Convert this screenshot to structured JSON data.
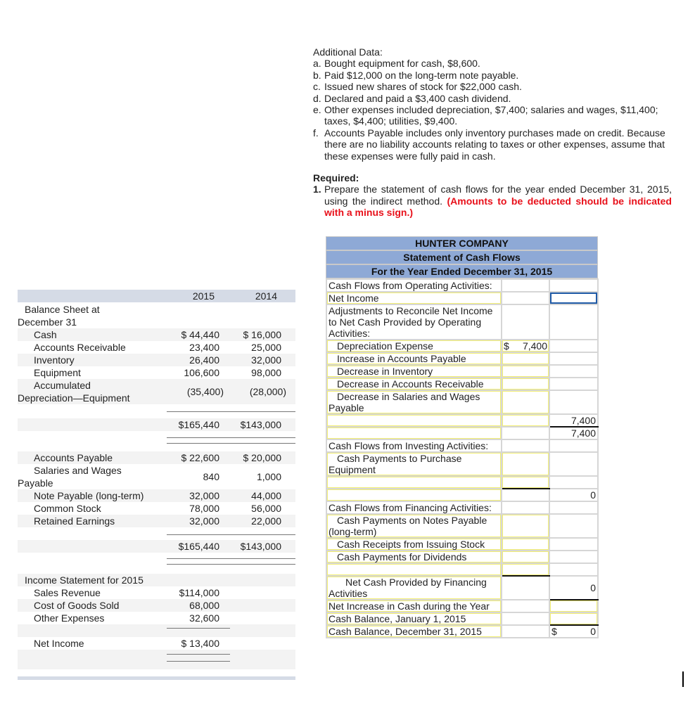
{
  "additional_data": {
    "title": "Additional Data:",
    "items": [
      {
        "label": "a.",
        "text": "Bought equipment for cash, $8,600."
      },
      {
        "label": "b.",
        "text": "Paid $12,000 on the long-term note payable."
      },
      {
        "label": "c.",
        "text": "Issued new shares of stock for $22,000 cash."
      },
      {
        "label": "d.",
        "text": "Declared and paid a $3,400 cash dividend."
      },
      {
        "label": "e.",
        "text": "Other expenses included depreciation, $7,400; salaries and wages, $11,400; taxes, $4,400; utilities, $9,400."
      },
      {
        "label": "f.",
        "text": "Accounts Payable includes only inventory purchases made on credit. Because there are no liability accounts relating to taxes or other expenses, assume that these expenses were fully paid in cash."
      }
    ]
  },
  "required": {
    "title": "Required:",
    "label": "1.",
    "text": "Prepare the statement of cash flows for the year ended December 31, 2015, using the indirect method. ",
    "note": "(Amounts to be deducted should be indicated with a minus sign.)",
    "note_color": "#e8101a"
  },
  "balance_sheet": {
    "col_2015": "2015",
    "col_2014": "2014",
    "title_line1": "Balance Sheet at",
    "title_line2": "December 31",
    "assets": [
      {
        "label": "Cash",
        "v2015": "$ 44,440",
        "v2014": "$ 16,000"
      },
      {
        "label": "Accounts Receivable",
        "v2015": "23,400",
        "v2014": "25,000"
      },
      {
        "label": "Inventory",
        "v2015": "26,400",
        "v2014": "32,000"
      },
      {
        "label": "Equipment",
        "v2015": "106,600",
        "v2014": "98,000"
      },
      {
        "label1": "Accumulated",
        "label2": "Depreciation—Equipment",
        "v2015": "(35,400)",
        "v2014": "(28,000)"
      }
    ],
    "total_assets": {
      "v2015": "$165,440",
      "v2014": "$143,000"
    },
    "liabilities": [
      {
        "label": "Accounts Payable",
        "v2015": "$ 22,600",
        "v2014": "$ 20,000"
      },
      {
        "label1": "Salaries and Wages",
        "label2": "Payable",
        "v2015": "840",
        "v2014": "1,000"
      },
      {
        "label": "Note Payable (long-term)",
        "v2015": "32,000",
        "v2014": "44,000"
      },
      {
        "label": "Common Stock",
        "v2015": "78,000",
        "v2014": "56,000"
      },
      {
        "label": "Retained Earnings",
        "v2015": "32,000",
        "v2014": "22,000"
      }
    ],
    "total_liabilities": {
      "v2015": "$165,440",
      "v2014": "$143,000"
    }
  },
  "income_statement": {
    "title": "Income Statement for 2015",
    "items": [
      {
        "label": "Sales Revenue",
        "value": "$114,000"
      },
      {
        "label": "Cost of Goods Sold",
        "value": "68,000"
      },
      {
        "label": "Other Expenses",
        "value": "32,600"
      }
    ],
    "net_income": {
      "label": "Net Income",
      "value": "$ 13,400"
    }
  },
  "cash_flow": {
    "company": "HUNTER COMPANY",
    "statement": "Statement of Cash Flows",
    "period": "For the Year Ended December 31, 2015",
    "operating_header": "Cash Flows from Operating Activities:",
    "net_income": "Net Income",
    "adjustments_header": "Adjustments to Reconcile Net Income to Net Cash Provided by Operating Activities:",
    "depreciation": {
      "label": "Depreciation Expense",
      "currency": "$",
      "value": "7,400"
    },
    "increase_ap": "Increase in Accounts Payable",
    "decrease_inventory": "Decrease in Inventory",
    "decrease_ar": "Decrease in Accounts Receivable",
    "decrease_salaries": "Decrease in Salaries and Wages Payable",
    "operating_subtotal": "7,400",
    "operating_total": "7,400",
    "investing_header": "Cash Flows from Investing Activities:",
    "purchase_equipment": "Cash Payments to Purchase Equipment",
    "investing_total": "0",
    "financing_header": "Cash Flows from Financing Activities:",
    "notes_payable": "Cash Payments on Notes Payable (long-term)",
    "issuing_stock": "Cash Receipts from Issuing Stock",
    "dividends": "Cash Payments for Dividends",
    "net_financing": {
      "label": "Net Cash Provided by Financing Activities",
      "value": "0"
    },
    "net_increase": "Net Increase in Cash during the Year",
    "cash_begin": "Cash Balance, January 1, 2015",
    "cash_end": {
      "label": "Cash Balance, December 31, 2015",
      "currency": "$",
      "value": "0"
    }
  }
}
